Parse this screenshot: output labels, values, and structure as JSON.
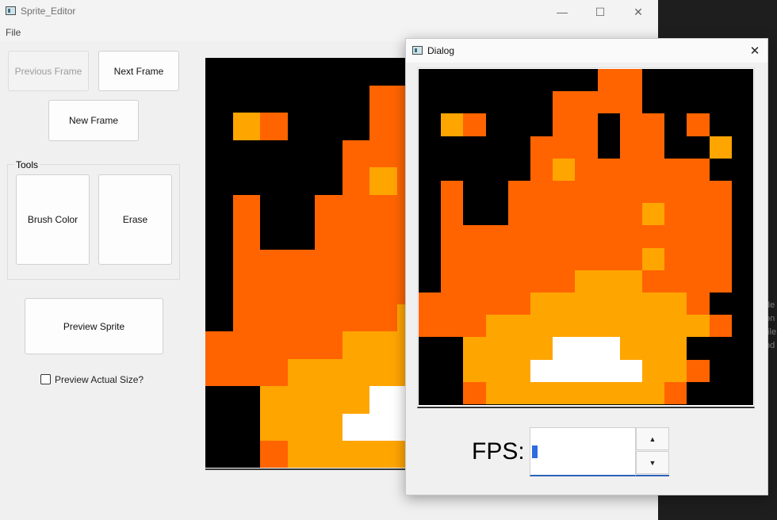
{
  "main_window": {
    "title": "Sprite_Editor",
    "menu": {
      "file": "File"
    },
    "buttons": {
      "previous_frame": "Previous Frame",
      "next_frame": "Next Frame",
      "new_frame": "New Frame",
      "brush_color": "Brush Color",
      "erase": "Erase",
      "preview_sprite": "Preview Sprite"
    },
    "tools_group_label": "Tools",
    "preview_actual_size": {
      "label": "Preview Actual Size?",
      "checked": false
    }
  },
  "background_text": [
    "de",
    "on",
    "file",
    "od"
  ],
  "dialog": {
    "title": "Dialog",
    "fps_label": "FPS:",
    "fps_value": ""
  },
  "colors": {
    "black": "#000000",
    "orange": "#ff6400",
    "yellow": "#ffa500",
    "white": "#ffffff"
  },
  "sprite_frame": {
    "grid_size": 15,
    "palette": {
      "0": "#000000",
      "1": "#ff6400",
      "2": "#ffa500",
      "3": "#ffffff"
    },
    "rows": [
      "000000001100000",
      "000000111100000",
      "021000110110100",
      "000001110110020",
      "000001211111100",
      "010011111111110",
      "010011111121110",
      "011111111111110",
      "011111111121110",
      "011111122211110",
      "111112222222100",
      "111222222222210",
      "002222333222000",
      "002223333322100",
      "001222222221000"
    ]
  }
}
